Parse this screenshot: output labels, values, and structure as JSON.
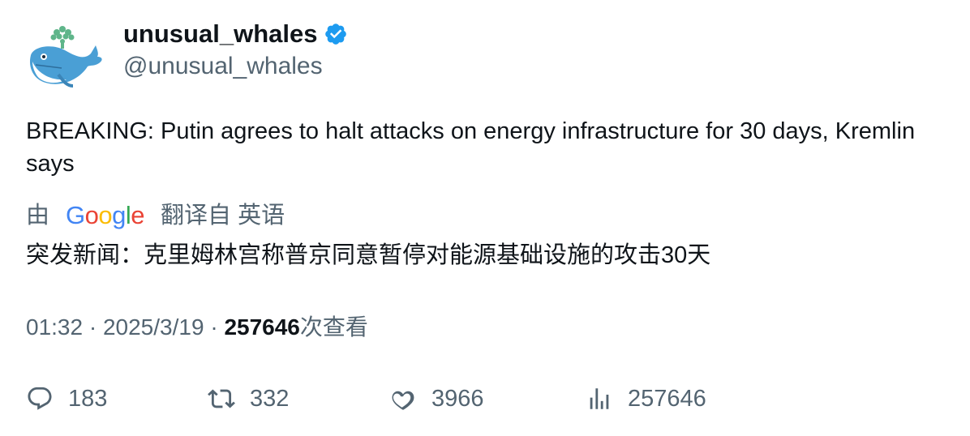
{
  "author": {
    "display_name": "unusual_whales",
    "handle": "@unusual_whales",
    "verified": true
  },
  "tweet": {
    "text": "BREAKING: Putin agrees to halt attacks on energy infrastructure for 30 days, Kremlin says"
  },
  "translation": {
    "prefix": "由",
    "provider": "Google",
    "suffix": "翻译自 英语",
    "text": "突发新闻：克里姆林宫称普京同意暂停对能源基础设施的攻击30天"
  },
  "meta": {
    "time": "01:32",
    "sep1": "·",
    "date": "2025/3/19",
    "sep2": "·",
    "views": "257646",
    "views_label": "次查看"
  },
  "actions": {
    "replies": "183",
    "retweets": "332",
    "likes": "3966",
    "views": "257646"
  },
  "colors": {
    "verified_badge": "#1d9bf0",
    "secondary_text": "#536471",
    "primary_text": "#0f1419"
  },
  "icons": [
    "whale-avatar-icon",
    "verified-badge-icon",
    "reply-icon",
    "retweet-icon",
    "like-icon",
    "views-chart-icon"
  ]
}
